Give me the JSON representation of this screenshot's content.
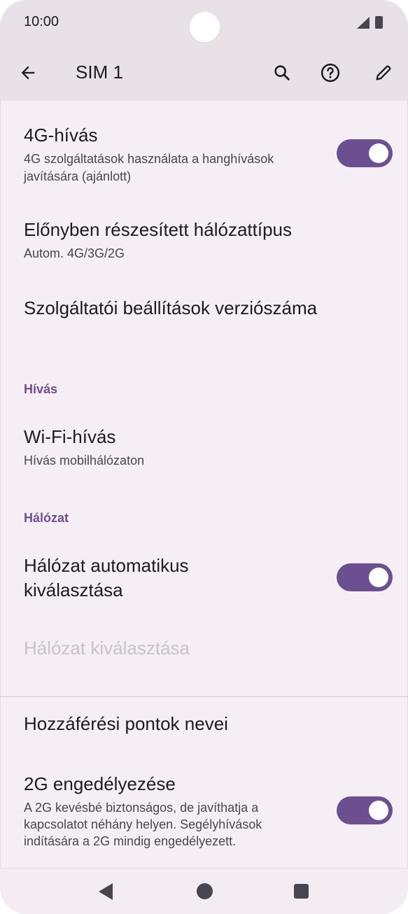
{
  "status_bar": {
    "time": "10:00"
  },
  "app_bar": {
    "title": "SIM 1"
  },
  "items": {
    "volte": {
      "title": "4G-hívás",
      "subtitle_line1": "4G szolgáltatások használata a hanghívások",
      "subtitle_line2": "javítására (ajánlott)",
      "enabled": true
    },
    "network_type": {
      "title": "Előnyben részesített hálózattípus",
      "subtitle": "Autom. 4G/3G/2G"
    },
    "carrier_version": {
      "title": "Szolgáltatói beállítások verziószáma"
    },
    "section_calling": "Hívás",
    "wifi_calling": {
      "title": "Wi-Fi-hívás",
      "subtitle": "Hívás mobilhálózaton"
    },
    "section_network": "Hálózat",
    "auto_select": {
      "title_line1": "Hálózat automatikus",
      "title_line2": "kiválasztása",
      "enabled": true
    },
    "choose_network": {
      "title": "Hálózat kiválasztása"
    },
    "apn": {
      "title": "Hozzáférési pontok nevei"
    },
    "allow_2g": {
      "title": "2G engedélyezése",
      "subtitle_line1": "A 2G kevésbé biztonságos, de javíthatja a",
      "subtitle_line2": "kapcsolatot néhány helyen. Segélyhívások",
      "subtitle_line3": "indítására a 2G mindig engedélyezett.",
      "enabled": true
    }
  },
  "colors": {
    "accent": "#6c4f91",
    "background": "#f6eef5",
    "appbar": "#e8e1e8"
  },
  "icons": [
    "back-arrow-icon",
    "search-icon",
    "help-icon",
    "edit-pencil-icon",
    "nav-back-icon",
    "nav-home-icon",
    "nav-recents-icon"
  ]
}
